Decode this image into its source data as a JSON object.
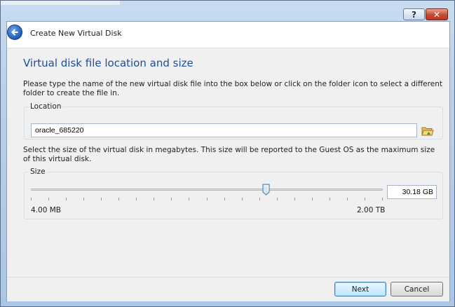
{
  "window": {
    "help_label": "?",
    "close_label": "✕"
  },
  "header": {
    "title": "Create New Virtual Disk"
  },
  "page": {
    "title": "Virtual disk file location and size",
    "location_description": "Please type the name of the new virtual disk file into the box below or click on the folder icon to select a different folder to create the file in.",
    "size_description": "Select the size of the virtual disk in megabytes. This size will be reported to the Guest OS as the maximum size of this virtual disk."
  },
  "location": {
    "group_label": "Location",
    "value": "oracle_685220",
    "folder_icon": "folder-open-icon"
  },
  "size": {
    "group_label": "Size",
    "value": "30.18 GB",
    "min_label": "4.00 MB",
    "max_label": "2.00 TB",
    "slider_fraction": 0.668,
    "tick_count": 21
  },
  "footer": {
    "next_label": "Next",
    "cancel_label": "Cancel"
  },
  "colors": {
    "title_blue": "#1e4f96",
    "accent_button": "#3c7fb1"
  }
}
